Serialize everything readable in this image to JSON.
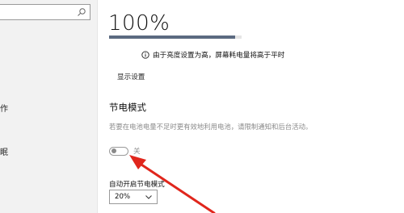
{
  "sidebar": {
    "search_placeholder": "",
    "fragments": [
      "作",
      "眠"
    ]
  },
  "brightness": {
    "value_text": "100%",
    "fill_fraction": 0.95
  },
  "info": {
    "text": "由于亮度设置为高，屏幕耗电量将高于平时"
  },
  "display_settings_link": "显示设置",
  "battery_saver": {
    "title": "节电模式",
    "description": "若要在电池电量不足时更有效地利用电池，请限制通知和后台活动。",
    "toggle_state": "关",
    "auto_label": "自动开启节电模式",
    "threshold_value": "20%"
  },
  "colors": {
    "annotation_arrow": "#e0261c",
    "bar_fill": "#5b6a80"
  },
  "icons": [
    "search-icon",
    "info-icon",
    "chevron-down-icon"
  ]
}
